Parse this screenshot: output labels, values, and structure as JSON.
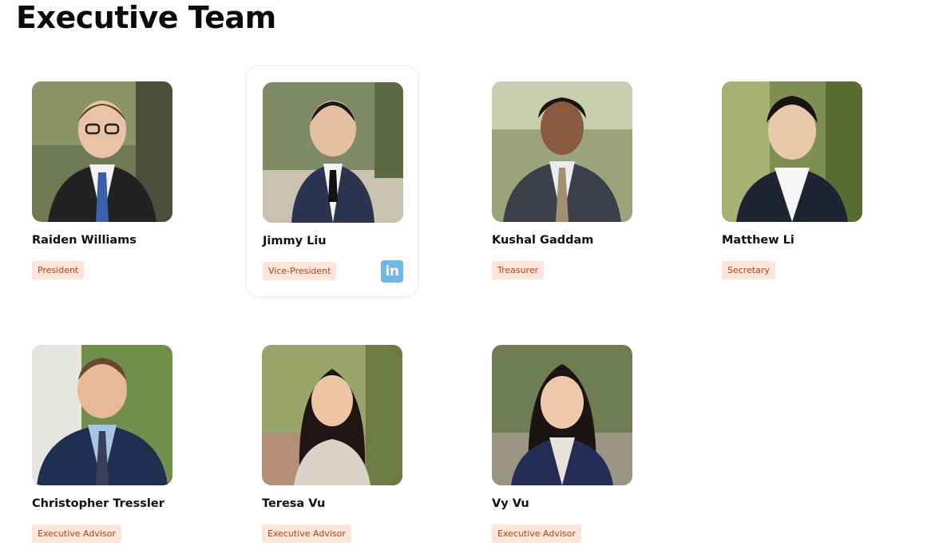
{
  "section": {
    "title": "Executive Team"
  },
  "members": [
    {
      "name": "Raiden Williams",
      "role": "President"
    },
    {
      "name": "Jimmy Liu",
      "role": "Vice-President",
      "linkedin": "in"
    },
    {
      "name": "Kushal Gaddam",
      "role": "Treasurer"
    },
    {
      "name": "Matthew Li",
      "role": "Secretary"
    },
    {
      "name": "Christopher Tressler",
      "role": "Executive Advisor"
    },
    {
      "name": "Teresa Vu",
      "role": "Executive Advisor"
    },
    {
      "name": "Vy Vu",
      "role": "Executive Advisor"
    }
  ],
  "colors": {
    "role_badge_bg": "#fde4d8",
    "role_badge_text": "#b4431a",
    "linkedin": "#6fb7e5"
  }
}
